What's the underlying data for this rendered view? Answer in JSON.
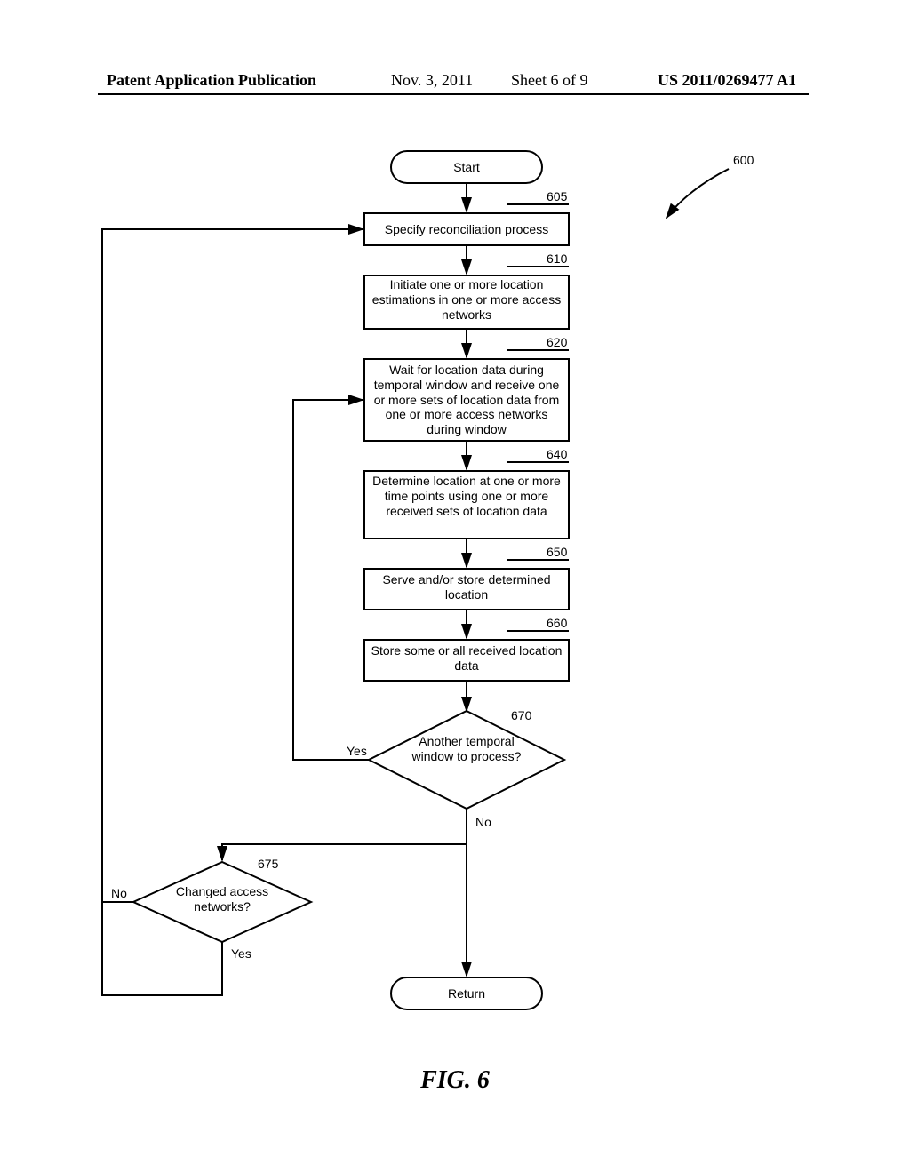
{
  "header": {
    "left": "Patent Application Publication",
    "date": "Nov. 3, 2011",
    "sheet": "Sheet 6 of 9",
    "docnum": "US 2011/0269477 A1"
  },
  "figure_label": "FIG. 6",
  "chart_data": {
    "type": "flowchart",
    "ref_number": "600",
    "nodes": [
      {
        "id": "start",
        "kind": "terminal",
        "text": "Start"
      },
      {
        "id": "605",
        "kind": "process",
        "ref": "605",
        "text": "Specify reconciliation process"
      },
      {
        "id": "610",
        "kind": "process",
        "ref": "610",
        "text": "Initiate one or more location estimations in one or more access networks"
      },
      {
        "id": "620",
        "kind": "process",
        "ref": "620",
        "text": "Wait for location data during temporal window and receive one or more sets of location data from one or more access networks during window"
      },
      {
        "id": "640",
        "kind": "process",
        "ref": "640",
        "text": "Determine location at one or more time points using one or more received sets of location data"
      },
      {
        "id": "650",
        "kind": "process",
        "ref": "650",
        "text": "Serve and/or store determined location"
      },
      {
        "id": "660",
        "kind": "process",
        "ref": "660",
        "text": "Store some or all received location data"
      },
      {
        "id": "670",
        "kind": "decision",
        "ref": "670",
        "text": "Another temporal window to process?"
      },
      {
        "id": "675",
        "kind": "decision",
        "ref": "675",
        "text": "Changed access networks?"
      },
      {
        "id": "return",
        "kind": "terminal",
        "text": "Return"
      }
    ],
    "edges": [
      {
        "from": "start",
        "to": "605"
      },
      {
        "from": "605",
        "to": "610"
      },
      {
        "from": "610",
        "to": "620"
      },
      {
        "from": "620",
        "to": "640"
      },
      {
        "from": "640",
        "to": "650"
      },
      {
        "from": "650",
        "to": "660"
      },
      {
        "from": "660",
        "to": "670"
      },
      {
        "from": "670",
        "to": "620",
        "label": "Yes"
      },
      {
        "from": "670",
        "to": "675",
        "label": "No"
      },
      {
        "from": "675",
        "to": "return",
        "label": "No"
      },
      {
        "from": "675",
        "to": "605",
        "label": "Yes"
      },
      {
        "from": "670_no_branch",
        "to": "return"
      }
    ],
    "labels": {
      "yes": "Yes",
      "no": "No"
    }
  }
}
